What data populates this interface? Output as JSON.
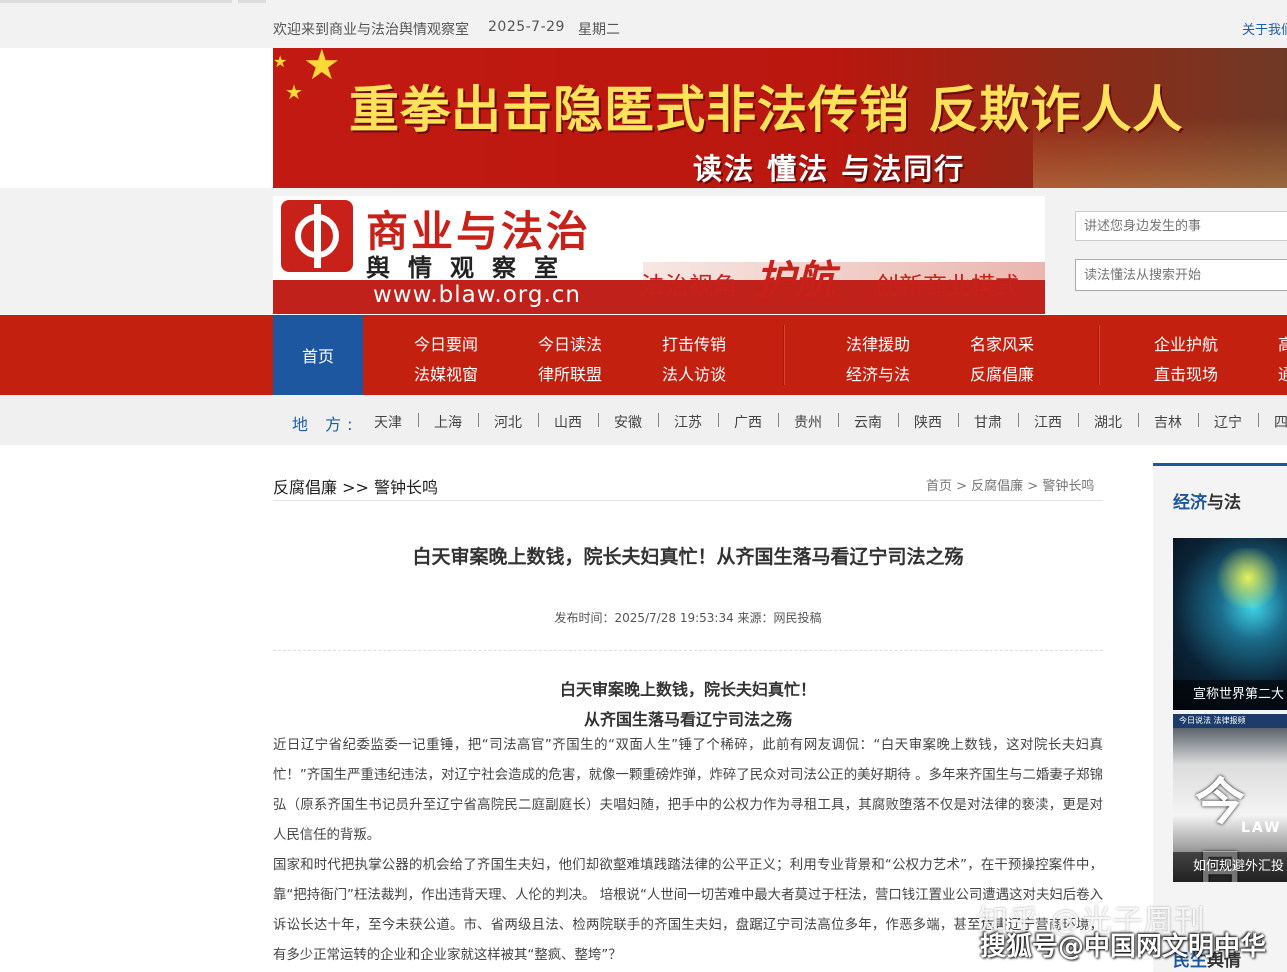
{
  "topbar": {
    "welcome": "欢迎来到商业与法治舆情观察室",
    "date": "2025-7-29",
    "weekday": "星期二",
    "about": "关于我们"
  },
  "banner": {
    "title": "重拳出击隐匿式非法传销 反欺诈人人",
    "subtitle": "读法 懂法 与法同行"
  },
  "logo": {
    "title": "商业与法治",
    "subtitle": "舆情观察室",
    "url": "www.blaw.org.cn",
    "slogan_a": "法治视角",
    "slogan_b": "护航",
    "slogan_c": "创新商业模式"
  },
  "search": {
    "placeholder1": "讲述您身边发生的事",
    "placeholder2": "读法懂法从搜索开始"
  },
  "nav": {
    "home": "首页",
    "items": [
      "今日要闻",
      "法媒视窗",
      "今日读法",
      "律所联盟",
      "打击传销",
      "法人访谈",
      "法律援助",
      "经济与法",
      "名家风采",
      "反腐倡廉",
      "企业护航",
      "直击现场",
      "高",
      "通"
    ]
  },
  "regions": {
    "label": "地 方:",
    "items": [
      "天津",
      "上海",
      "河北",
      "山西",
      "安徽",
      "江苏",
      "广西",
      "贵州",
      "云南",
      "陕西",
      "甘肃",
      "江西",
      "湖北",
      "吉林",
      "辽宁",
      "四"
    ]
  },
  "breadcrumb": {
    "left": "反腐倡廉 >> 警钟长鸣",
    "right": "首页 > 反腐倡廉 > 警钟长鸣"
  },
  "article": {
    "title": "白天审案晚上数钱，院长夫妇真忙！从齐国生落马看辽宁司法之殇",
    "meta": "发布时间：2025/7/28 19:53:34   来源：网民投稿",
    "sub1": "白天审案晚上数钱，院长夫妇真忙！",
    "sub2": "从齐国生落马看辽宁司法之殇",
    "para1": "近日辽宁省纪委监委一记重锤，把“司法高官”齐国生的“双面人生”锤了个稀碎，此前有网友调侃：“白天审案晚上数钱，这对院长夫妇真忙！”齐国生严重违纪违法，对辽宁社会造成的危害，就像一颗重磅炸弹，炸碎了民众对司法公正的美好期待 。多年来齐国生与二婚妻子郑锦弘（原系齐国生书记员升至辽宁省高院民二庭副庭长）夫唱妇随，把手中的公权力作为寻租工具，其腐败堕落不仅是对法律的亵渎，更是对人民信任的背叛。",
    "para2": "国家和时代把执掌公器的机会给了齐国生夫妇，他们却欲壑难填践踏法律的公平正义；利用专业背景和“公权力艺术”，在干预操控案件中，靠“把持衙门”枉法裁判，作出违背天理、人伦的判决。 培根说“人世间一切苦难中最大者莫过于枉法，营口钱江置业公司遭遇这对夫妇后卷入诉讼长达十年，至今未获公道。市、省两级且法、检两院联手的齐国生夫妇，盘踞辽宁司法高位多年，作恶多端，甚至危害辽宁营商环境，有多少正常运转的企业和企业家就这样被其“整疯、整垮”？"
  },
  "sidebar": {
    "title_highlight": "经济",
    "title_rest": "与法",
    "caption1": "宣称世界第二大",
    "thumb2_header": "今日说法 法律报频",
    "thumb2_big": "今日",
    "thumb2_law": "LAW",
    "caption2": "如何规避外汇投",
    "bottom_highlight": "民生",
    "bottom_rest": "舆情"
  },
  "watermarks": {
    "line1": "知乎 @光子周刊",
    "line2": "搜狐号@中国网文明中华"
  },
  "colors": {
    "nav_red": "#c4200f",
    "home_blue": "#1d57a0",
    "link_blue": "#1a5fa8"
  }
}
